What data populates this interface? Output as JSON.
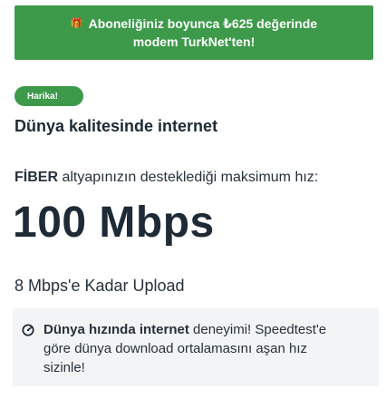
{
  "banner": {
    "gift_icon": "gift-icon",
    "line1": "Aboneliğiniz boyunca ₺625 değerinde",
    "line2": "modem TurkNet'ten!"
  },
  "badge": {
    "label": "Harika!"
  },
  "heading": "Dünya kalitesinde internet",
  "subtitle": {
    "bold": "FİBER",
    "rest": " altyapınızın desteklediği maksimum hız:"
  },
  "speed": "100 Mbps",
  "upload": "8 Mbps'e Kadar Upload",
  "feature": {
    "icon": "speedometer-icon",
    "bold": "Dünya hızında internet",
    "rest": " deneyimi! Speedtest'e göre dünya download ortalamasını aşan hız sizinle!"
  },
  "colors": {
    "brand_green": "#3d9a4a",
    "text_dark": "#1e2a35",
    "feature_bg": "#f3f4f5"
  }
}
